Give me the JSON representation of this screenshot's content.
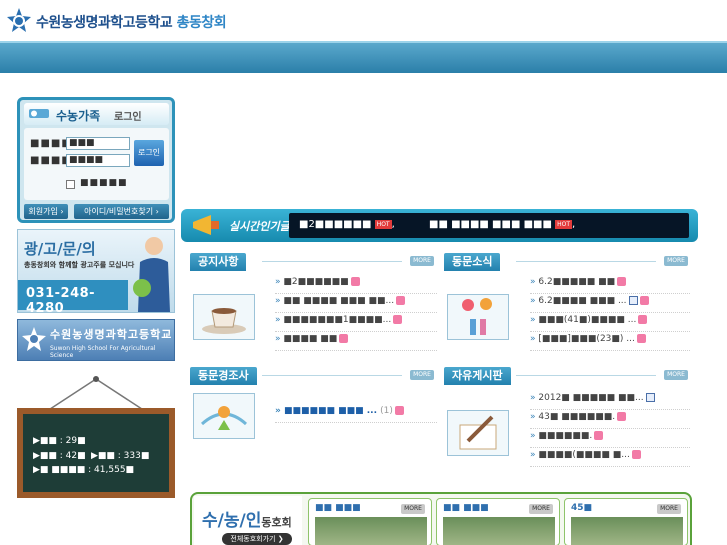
{
  "header": {
    "logo_text_main": "수원농생명과학고등학교",
    "logo_text_accent": "총동창회"
  },
  "login": {
    "title_main": "수농가족",
    "title_sub": "로그인",
    "id_label": "■■■■",
    "id_value": "■■■",
    "pw_label": "■■■■",
    "pw_value": "■■■■",
    "login_button": "로그인",
    "remember_label": "■■■■■",
    "join_button": "회원가입 ›",
    "find_button": "아이디/비밀번호찾기 ›"
  },
  "ad": {
    "title": "광/고/문/의",
    "subtitle": "총동창회와 함께할 광고주를 모십니다",
    "phone": "031-248-4280"
  },
  "school": {
    "name_ko": "수원농생명과학고등학교",
    "name_en": "Suwon High School For Agricultural Science"
  },
  "board": {
    "line1": "▶■■ : 29■",
    "line2a": "▶■■ : 42■",
    "line2b": "▶■■ : 333■",
    "line3": "▶■ ■■■■ : 41,555■"
  },
  "realtime": {
    "label": "실시간인기글",
    "item1": "■2■■■■■■",
    "item1_tail": ",",
    "item2": "■■ ■■■■ ■■■ ■■■",
    "item2_tail": ",",
    "hot": "HOT"
  },
  "more_label": "MORE",
  "notice": {
    "title": "공지사항",
    "posts": [
      "■2■■■■■■",
      "■■ ■■■■ ■■■ ■■...",
      "■■■■■■■1■■■■...",
      "■■■■ ■■"
    ]
  },
  "alumni_news": {
    "title": "동문소식",
    "posts": [
      "6.2■■■■■ ■■",
      "6.2■■■■ ■■■ ...",
      "■■■(41■)■■■■ ...",
      "[■■■]■■■(23■) ..."
    ]
  },
  "condolence": {
    "title": "동문경조사",
    "posts": [
      "■■■■■■ ■■■ ..."
    ],
    "count": "(1)"
  },
  "free_board": {
    "title": "자유게시판",
    "posts": [
      "2012■ ■■■■■ ■■...",
      "43■ ■■■■■■.",
      "■■■■■■.",
      "■■■■(■■■■ ■..."
    ]
  },
  "sunongin": {
    "title_main": "수/농/인",
    "title_sub": "동호회",
    "all_button": "전체동호회가기 ❯",
    "cards": [
      "■■ ■■■",
      "■■ ■■■",
      "45■"
    ]
  }
}
